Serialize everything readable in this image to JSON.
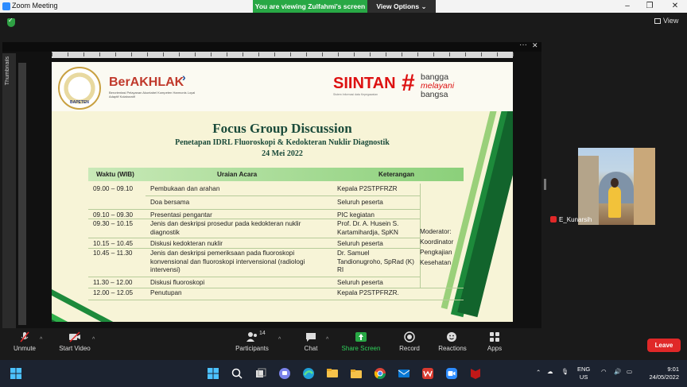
{
  "window": {
    "title": "Zoom Meeting"
  },
  "share_bar": {
    "viewing_label": "You are viewing Zulfahmi's screen",
    "view_options_label": "View Options"
  },
  "meeting": {
    "view_label": "View",
    "thumbnails_label": "Thumbnails"
  },
  "slide": {
    "logos": {
      "bapeten_text": "BAPETEN",
      "berakhlak_name": "BerAKHLAK",
      "berakhlak_tagline": "Berorientasi Pelayanan Akuntabel Kompeten Harmonis Loyal Adaptif Kolaboratif",
      "siintan_name": "SIINTAN",
      "siintan_sub": "Sistem Informasi data Kepegawaian",
      "bangga_lines": [
        "bangga",
        "melayani",
        "bangsa"
      ]
    },
    "title": "Focus Group Discussion",
    "subtitle": "Penetapan IDRL Fluoroskopi & Kedokteran Nuklir Diagnostik",
    "date": "24 Mei 2022",
    "table": {
      "headers": [
        "Waktu (WIB)",
        "Uraian Acara",
        "Keterangan"
      ],
      "rows": [
        {
          "time": "09.00 – 09.10",
          "desc": "Pembukaan dan arahan",
          "note": "Kepala P2STPFRZR"
        },
        {
          "time": "",
          "desc": "Doa bersama",
          "note": "Seluruh peserta"
        },
        {
          "time": "09.10 – 09.30",
          "desc": "Presentasi pengantar",
          "note": "PIC kegiatan"
        },
        {
          "time": "09.30 – 10.15",
          "desc": "Jenis dan deskripsi prosedur pada kedokteran nuklir diagnostik",
          "note": "Prof. Dr. A. Husein S. Kartamihardja, SpKN"
        },
        {
          "time": "10.15 – 10.45",
          "desc": "Diskusi kedokteran nuklir",
          "note": "Seluruh peserta"
        },
        {
          "time": "10.45 – 11.30",
          "desc": "Jenis dan deskripsi pemeriksaan pada fluoroskopi konvensional dan fluoroskopi intervensional (radiologi intervensi)",
          "note": "Dr. Samuel Tandionugroho, SpRad (K) RI"
        },
        {
          "time": "11.30 – 12.00",
          "desc": "Diskusi fluoroskopi",
          "note": "Seluruh peserta"
        },
        {
          "time": "12.00 – 12.05",
          "desc": "Penutupan",
          "note": "Kepala P2STPFRZR."
        }
      ],
      "moderator": [
        "Moderator:",
        "Koordinator",
        "Pengkajian",
        "Kesehatan"
      ]
    }
  },
  "participant": {
    "name": "E_Kunarsih"
  },
  "toolbar": {
    "unmute": "Unmute",
    "start_video": "Start Video",
    "participants": "Participants",
    "participants_count": "14",
    "chat": "Chat",
    "share_screen": "Share Screen",
    "record": "Record",
    "reactions": "Reactions",
    "apps": "Apps",
    "leave": "Leave"
  },
  "taskbar": {
    "language": "ENG",
    "region": "US",
    "time": "9:01",
    "date": "24/05/2022"
  },
  "colors": {
    "share_banner": "#28a845",
    "leave": "#e02828",
    "slide_bg": "#f7f4d7",
    "stripe_green": "#1d8a3b",
    "title_green": "#1a4a3a",
    "header_gradient_end": "#8bd07a"
  }
}
